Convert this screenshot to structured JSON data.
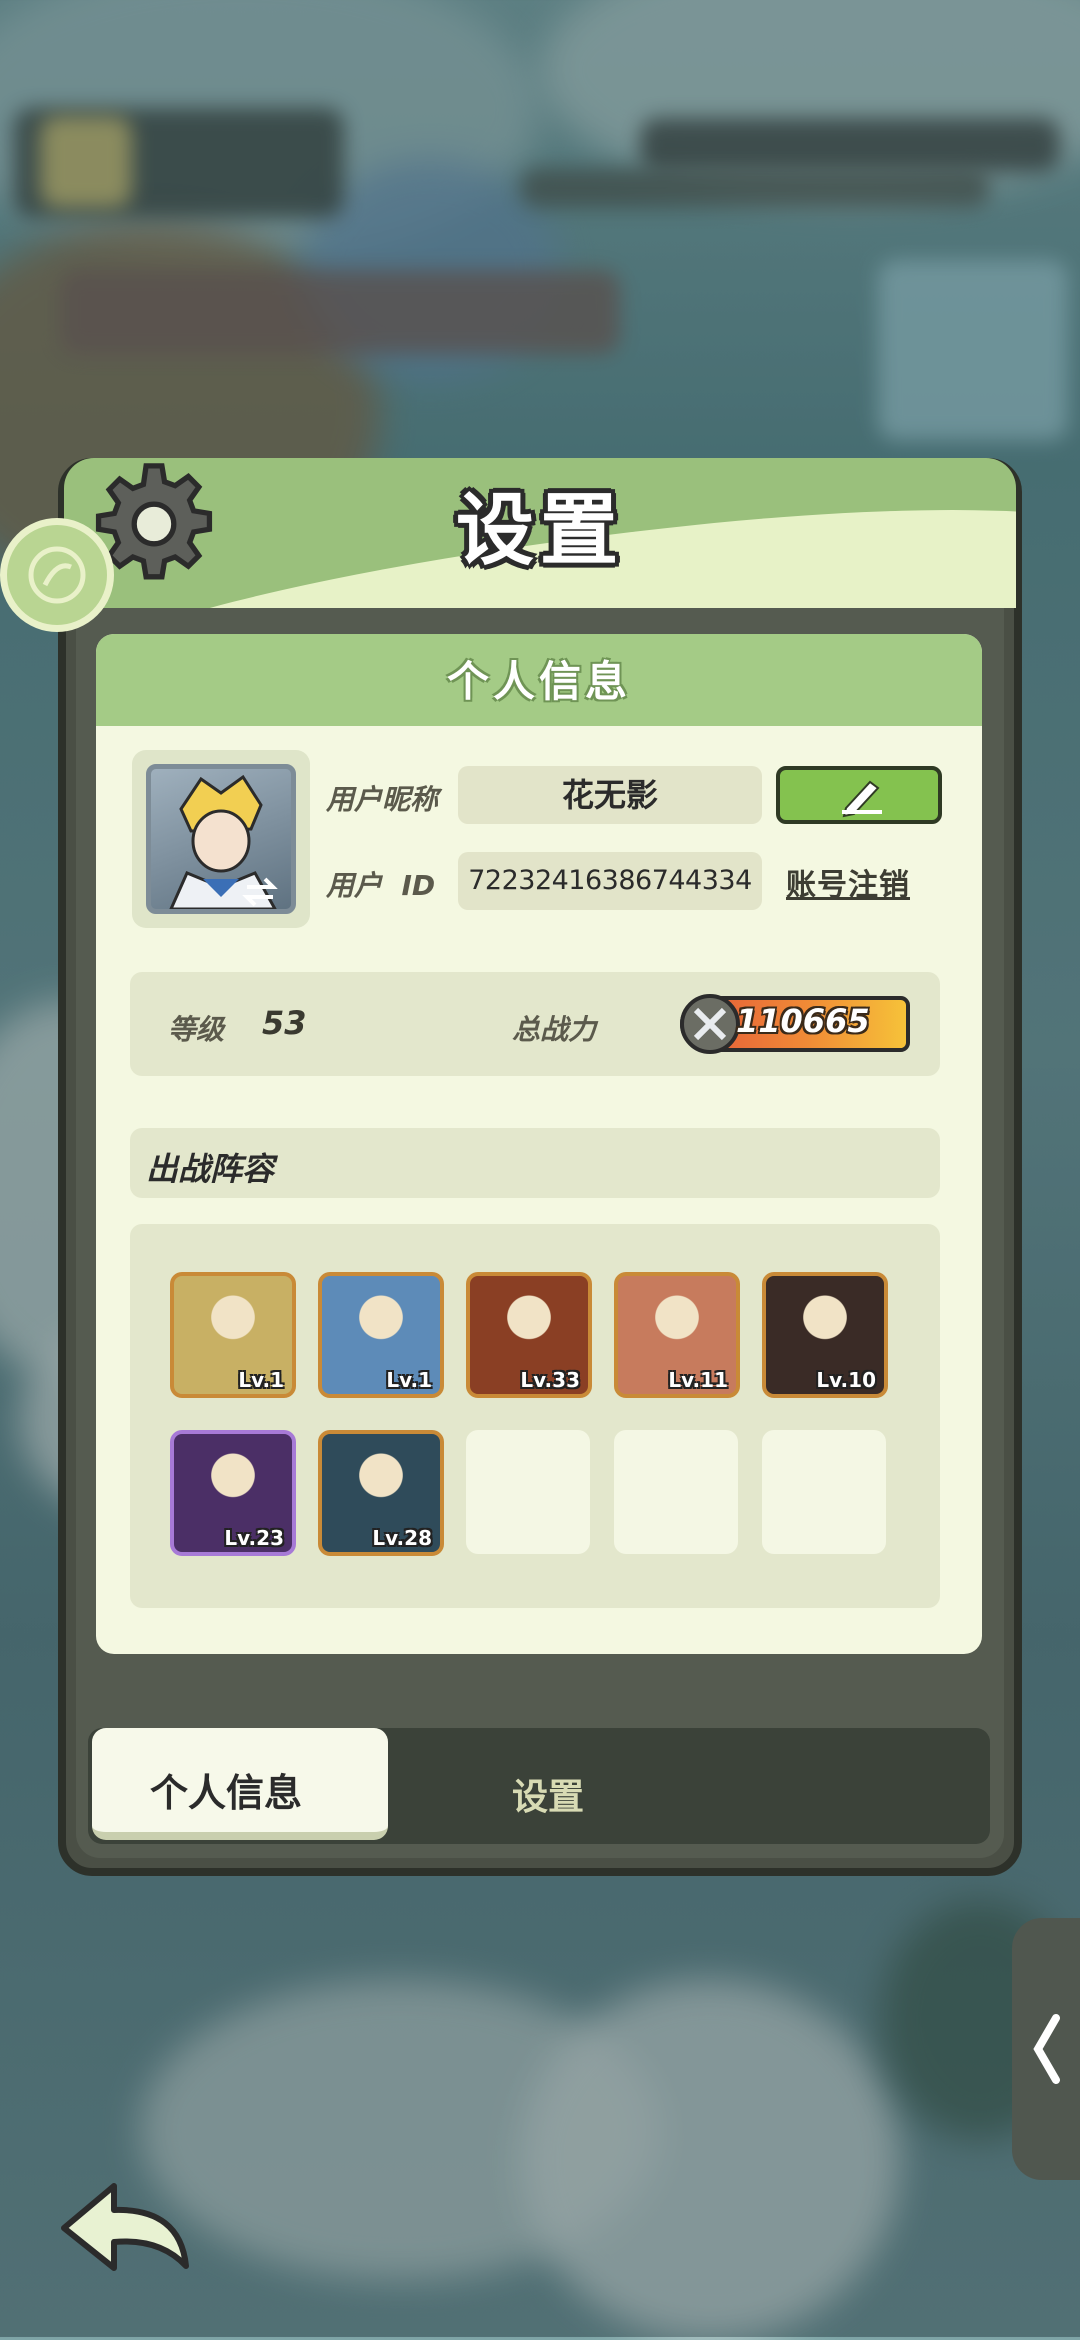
{
  "panel": {
    "title": "设置"
  },
  "personal_card": {
    "heading": "个人信息",
    "nickname_label": "用户昵称",
    "nickname_value": "花无影",
    "id_label": "用户",
    "id_label_suffix": "ID",
    "id_value": "72232416386744334",
    "cancel_account_label": "账号注销"
  },
  "stats": {
    "level_label": "等级",
    "level_value": "53",
    "power_label": "总战力",
    "power_value": "110665"
  },
  "lineup": {
    "heading": "出战阵容",
    "heroes": [
      {
        "level": "Lv.1",
        "color": "#c8b064"
      },
      {
        "level": "Lv.1",
        "color": "#5d8bb8"
      },
      {
        "level": "Lv.33",
        "color": "#8a3f24"
      },
      {
        "level": "Lv.11",
        "color": "#c77b5d"
      },
      {
        "level": "Lv.10",
        "color": "#3a2b26"
      },
      {
        "level": "Lv.23",
        "color": "#4b2f66"
      },
      {
        "level": "Lv.28",
        "color": "#2f4b5a"
      }
    ],
    "empty_slots": 3
  },
  "tabs": {
    "personal_info": "个人信息",
    "settings": "设置"
  },
  "icons": {
    "gear": "gear-icon",
    "edit": "pencil-icon",
    "back": "back-arrow-icon",
    "power": "crossed-swords-icon",
    "side_toggle": "chevron-left-icon"
  }
}
